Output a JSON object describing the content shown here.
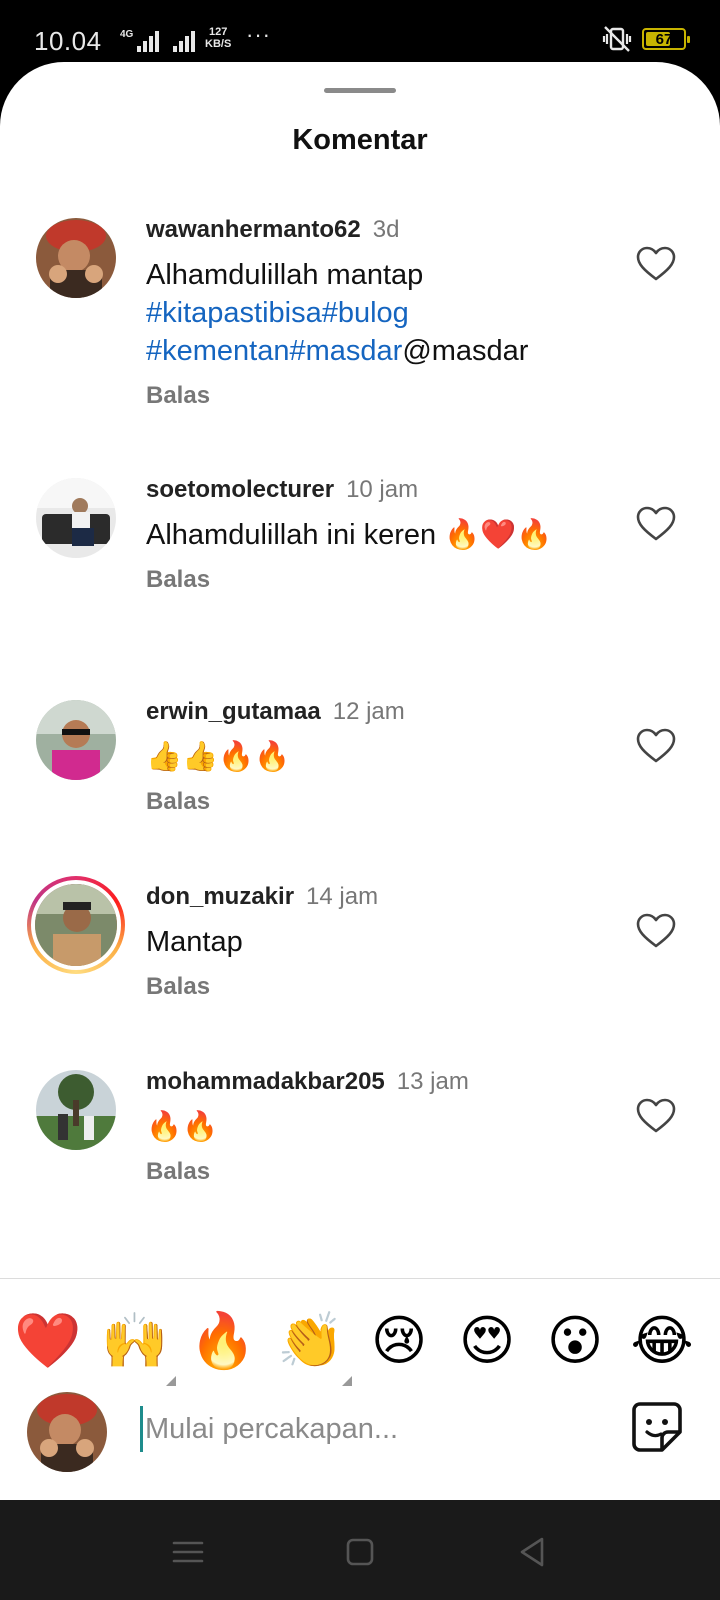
{
  "status_bar": {
    "time": "10.04",
    "network_type": "4G",
    "speed_value": "127",
    "speed_unit": "KB/S",
    "overflow": "···",
    "battery_level": "67",
    "battery_fraction": 0.67
  },
  "sheet": {
    "title": "Komentar"
  },
  "comments": [
    {
      "username": "wawanhermanto62",
      "time": "3d",
      "text_plain": "Alhamdulillah mantap ",
      "tags": [
        "#kitapastibisa",
        "#bulog",
        "#kementan",
        "#masdar"
      ],
      "mention": "@masdar",
      "reply_label": "Balas"
    },
    {
      "username": "soetomolecturer",
      "time": "10 jam",
      "text": "Alhamdulillah ini keren 🔥❤️🔥",
      "reply_label": "Balas"
    },
    {
      "username": "erwin_gutamaa",
      "time": "12 jam",
      "text": "👍👍🔥🔥",
      "reply_label": "Balas"
    },
    {
      "username": "don_muzakir",
      "time": "14 jam",
      "text": "Mantap",
      "reply_label": "Balas"
    },
    {
      "username": "mohammadakbar205",
      "time": "13 jam",
      "text": "🔥🔥",
      "reply_label": "Balas"
    }
  ],
  "quick_reactions": [
    "❤️",
    "🙌",
    "🔥",
    "👏",
    "😢",
    "😍",
    "😮",
    "😂"
  ],
  "composer": {
    "placeholder": "Mulai percakapan...",
    "value": ""
  }
}
